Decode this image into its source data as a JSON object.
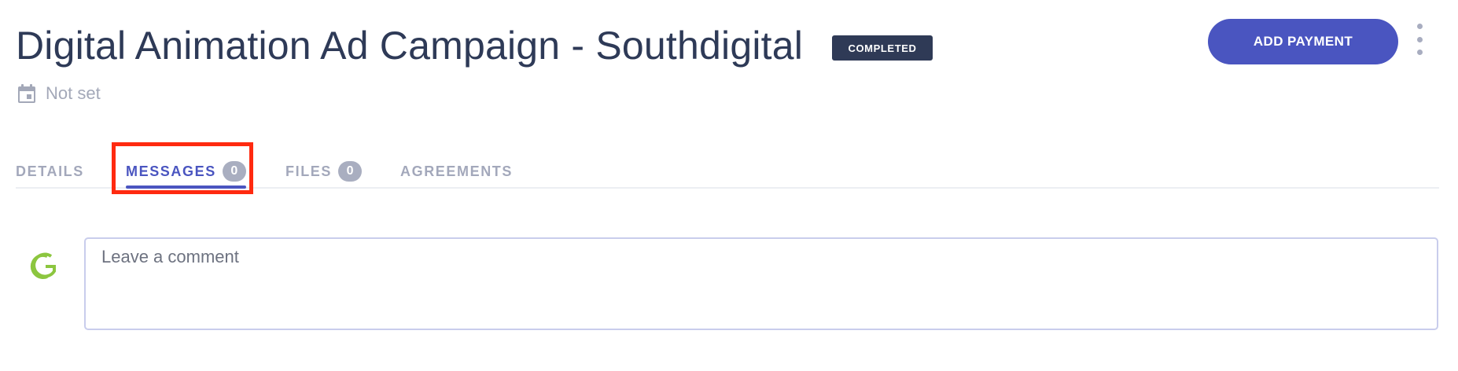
{
  "header": {
    "title": "Digital Animation Ad Campaign - Southdigital",
    "status": "COMPLETED",
    "add_payment_label": "ADD PAYMENT",
    "more_icon": "kebab-vertical-icon",
    "due_date_icon": "calendar-icon",
    "due_date": "Not set"
  },
  "tabs": [
    {
      "label": "DETAILS",
      "count": null
    },
    {
      "label": "MESSAGES",
      "count": "0",
      "active": true
    },
    {
      "label": "FILES",
      "count": "0"
    },
    {
      "label": "AGREEMENTS",
      "count": null
    }
  ],
  "comment": {
    "avatar_icon": "company-logo-g-icon",
    "placeholder": "Leave a comment"
  },
  "colors": {
    "accent": "#4a55c0",
    "badge_bg": "#2f3a56",
    "highlight": "#ff2a10",
    "muted": "#a3a8bb",
    "logo_green": "#8cc63f"
  }
}
